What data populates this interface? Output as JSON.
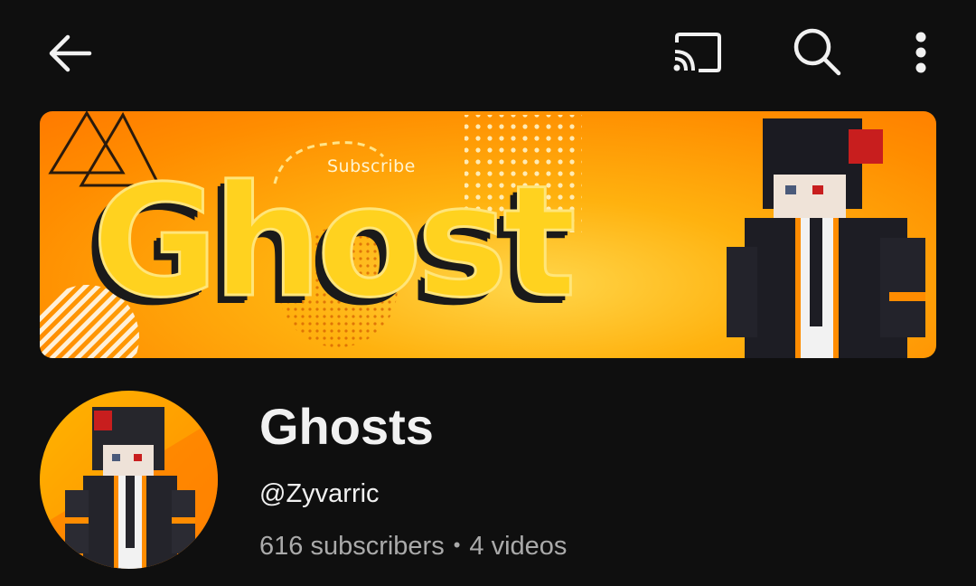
{
  "topbar": {
    "back_icon": "arrow-left-icon",
    "cast_icon": "cast-icon",
    "search_icon": "search-icon",
    "more_icon": "more-vertical-icon"
  },
  "banner": {
    "word": "Ghost",
    "subscribe_text": "Subscribe",
    "colors": {
      "primary": "#ff8d00",
      "highlight": "#ffd21f"
    }
  },
  "channel": {
    "name": "Ghosts",
    "handle": "@Zyvarric",
    "subscribers": "616 subscribers",
    "separator": "•",
    "videos": "4 videos"
  }
}
